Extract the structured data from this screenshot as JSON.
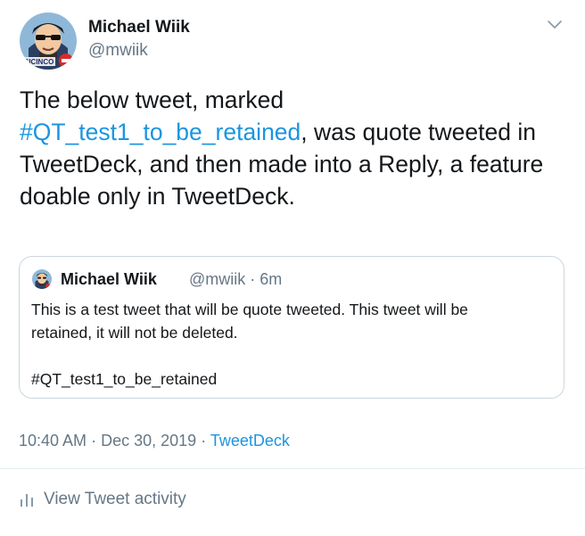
{
  "author": {
    "name": "Michael Wiik",
    "handle": "@mwiik",
    "avatar_badge_text": "SICINCO"
  },
  "menu_icon": "chevron-down-icon",
  "tweet": {
    "text_before": "The below tweet, marked ",
    "hashtag": "#QT_test1_to_be_retained",
    "text_after": ", was quote tweeted in TweetDeck, and then made into a Reply, a feature doable only in TweetDeck."
  },
  "quoted_tweet": {
    "name": "Michael Wiik",
    "handle": "@mwiik",
    "separator": "·",
    "age": "6m",
    "line1": "This is a test tweet that will be quote tweeted. This tweet will be",
    "line2": "retained, it will not be deleted.",
    "hashtag_line": "#QT_test1_to_be_retained"
  },
  "meta": {
    "time": "10:40 AM",
    "separator": "·",
    "date": "Dec 30, 2019",
    "source": "TweetDeck"
  },
  "activity": {
    "label": "View Tweet activity",
    "icon": "bar-chart-icon"
  },
  "colors": {
    "link": "#1b95e0",
    "secondary_text": "#657786",
    "primary_text": "#14171a",
    "border": "#ccd6dd"
  }
}
